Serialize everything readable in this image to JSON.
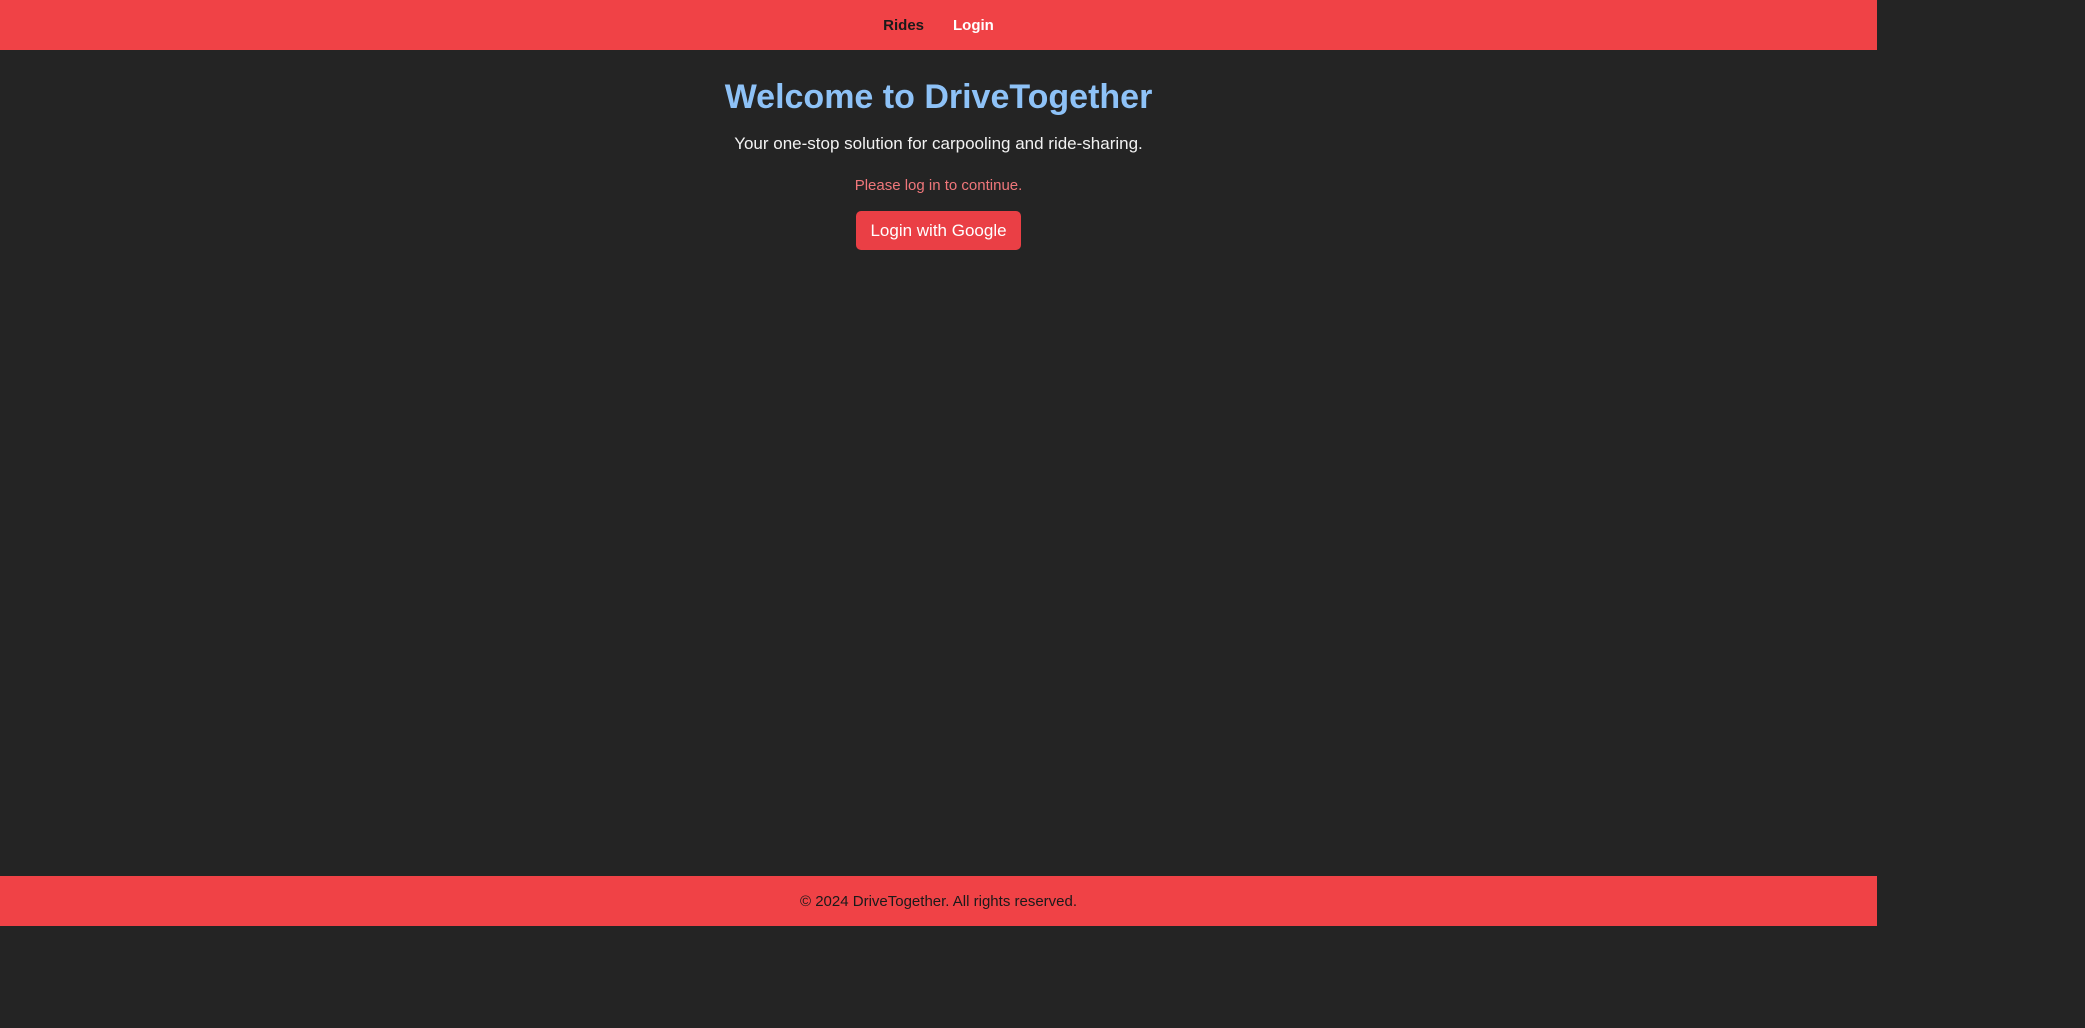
{
  "nav": {
    "items": [
      {
        "label": "Rides"
      },
      {
        "label": "Login"
      }
    ]
  },
  "main": {
    "title": "Welcome to DriveTogether",
    "subtitle": "Your one-stop solution for carpooling and ride-sharing.",
    "notice": "Please log in to continue.",
    "login_button": "Login with Google"
  },
  "footer": {
    "text": "© 2024 DriveTogether. All rights reserved."
  },
  "colors": {
    "background": "#242424",
    "brand_red": "#f04246",
    "title_blue": "#8ec2f7",
    "notice_red": "#f0777b"
  }
}
